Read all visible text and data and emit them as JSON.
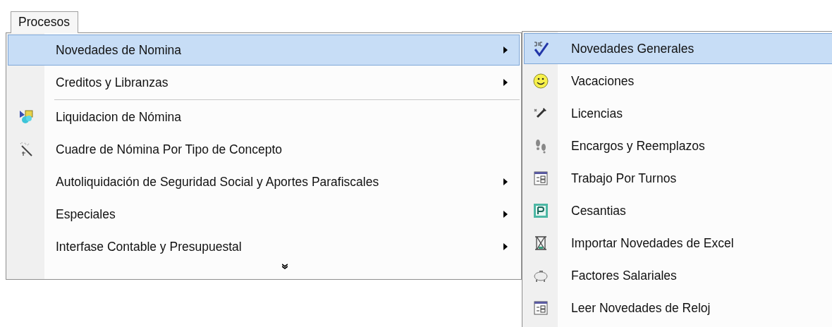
{
  "menu_bar": {
    "label": "Procesos"
  },
  "menu": [
    {
      "kind": "item",
      "label": "Novedades de Nomina",
      "selected": true,
      "submenu": true
    },
    {
      "kind": "item",
      "label": "Creditos y Libranzas",
      "selected": false,
      "submenu": true
    },
    {
      "kind": "separator"
    },
    {
      "kind": "item",
      "label": "Liquidacion de Nómina",
      "selected": false,
      "submenu": false
    },
    {
      "kind": "item",
      "label": "Cuadre de Nómina Por Tipo de Concepto",
      "selected": false,
      "submenu": false
    },
    {
      "kind": "item",
      "label": "Autoliquidación de Seguridad Social y Aportes Parafiscales",
      "selected": false,
      "submenu": true
    },
    {
      "kind": "item",
      "label": "Especiales",
      "selected": false,
      "submenu": true
    },
    {
      "kind": "item",
      "label": "Interfase Contable y Presupuestal",
      "selected": false,
      "submenu": true
    },
    {
      "kind": "more"
    }
  ],
  "submenu": [
    {
      "label": "Novedades Generales",
      "selected": true
    },
    {
      "label": "Vacaciones",
      "selected": false
    },
    {
      "label": "Licencias",
      "selected": false
    },
    {
      "label": "Encargos y Reemplazos",
      "selected": false
    },
    {
      "label": "Trabajo Por Turnos",
      "selected": false
    },
    {
      "label": "Cesantias",
      "selected": false
    },
    {
      "label": "Importar Novedades de Excel",
      "selected": false
    },
    {
      "label": "Factores Salariales",
      "selected": false
    },
    {
      "label": "Leer Novedades de Reloj",
      "selected": false
    }
  ]
}
